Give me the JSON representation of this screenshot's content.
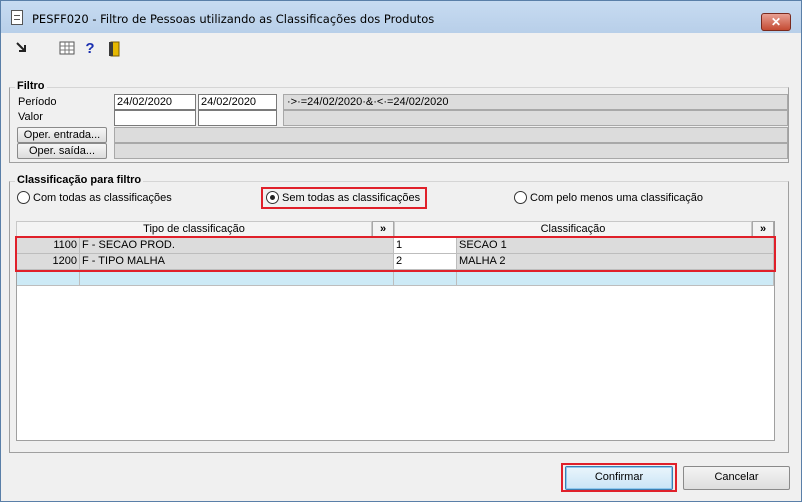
{
  "window": {
    "title": "PESFF020 - Filtro de Pessoas utilizando as Classificações dos Produtos",
    "close_label": "✕"
  },
  "toolbar": {
    "icons": [
      "export-icon",
      "grid-icon",
      "help-icon",
      "exit-door-icon"
    ],
    "help_glyph": "?"
  },
  "filtro": {
    "group_label": "Filtro",
    "periodo_label": "Período",
    "valor_label": "Valor",
    "date_from": "24/02/2020",
    "date_to": "24/02/2020",
    "expression": "·>·=24/02/2020·&·<·=24/02/2020",
    "oper_entrada_label": "Oper. entrada...",
    "oper_saida_label": "Oper. saída..."
  },
  "classificacao": {
    "group_label": "Classificação para filtro",
    "options": [
      {
        "label": "Com todas as classificações",
        "selected": false
      },
      {
        "label": "Sem todas as classificações",
        "selected": true
      },
      {
        "label": "Com pelo menos uma classificação",
        "selected": false
      }
    ],
    "table": {
      "headers": [
        "Tipo de classificação",
        "Classificação"
      ],
      "expand_label": "»",
      "rows": [
        {
          "code": "1100",
          "tipo": "F - SECAO PROD.",
          "cls_code": "1",
          "cls": "SECAO 1"
        },
        {
          "code": "1200",
          "tipo": "F - TIPO MALHA",
          "cls_code": "2",
          "cls": "MALHA 2"
        }
      ]
    }
  },
  "actions": {
    "confirm_label": "Confirmar",
    "cancel_label": "Cancelar"
  },
  "colors": {
    "highlight": "#e0202a",
    "new_row": "#cdeaf6",
    "readonly": "#dcdcdc"
  }
}
